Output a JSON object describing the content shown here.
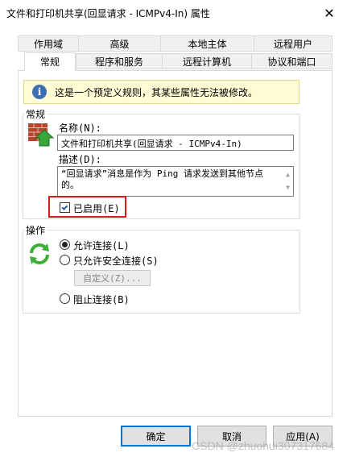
{
  "window": {
    "title": "文件和打印机共享(回显请求 - ICMPv4-In) 属性"
  },
  "tabs_row1": [
    "作用域",
    "高级",
    "本地主体",
    "远程用户"
  ],
  "tabs_row2": [
    "常规",
    "程序和服务",
    "远程计算机",
    "协议和端口"
  ],
  "info_banner": "这是一个预定义规则，其某些属性无法被修改。",
  "general": {
    "group_label": "常规",
    "name_label": "名称(N):",
    "name_value": "文件和打印机共享(回显请求 - ICMPv4-In)",
    "desc_label": "描述(D):",
    "desc_value": "“回显请求”消息是作为 Ping 请求发送到其他节点的。",
    "enabled_label": "已启用(E)",
    "enabled_checked": true
  },
  "action": {
    "group_label": "操作",
    "allow_label": "允许连接(L)",
    "secure_label": "只允许安全连接(S)",
    "customize_label": "自定义(Z)...",
    "block_label": "阻止连接(B)",
    "selected": "allow"
  },
  "buttons": {
    "ok": "确定",
    "cancel": "取消",
    "apply": "应用(A)"
  },
  "watermark": "CSDN @zhuohui307317684",
  "colors": {
    "accent": "#0078d7",
    "highlight": "#d9171b",
    "banner": "#fffbd4"
  }
}
